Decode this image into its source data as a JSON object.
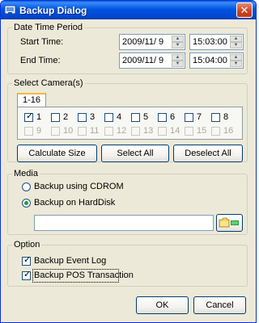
{
  "window": {
    "title": "Backup Dialog",
    "close_glyph": "✕"
  },
  "datetime": {
    "group_label": "Date Time Period",
    "start_label": "Start Time:",
    "start_date": "2009/11/  9",
    "start_time": "15:03:00",
    "end_label": "End Time:",
    "end_date": "2009/11/  9",
    "end_time": "15:04:00"
  },
  "cameras": {
    "group_label": "Select Camera(s)",
    "tab_label": "1-16",
    "items": [
      {
        "label": "1",
        "checked": true,
        "enabled": true
      },
      {
        "label": "2",
        "checked": false,
        "enabled": true
      },
      {
        "label": "3",
        "checked": false,
        "enabled": true
      },
      {
        "label": "4",
        "checked": false,
        "enabled": true
      },
      {
        "label": "5",
        "checked": false,
        "enabled": true
      },
      {
        "label": "6",
        "checked": false,
        "enabled": true
      },
      {
        "label": "7",
        "checked": false,
        "enabled": true
      },
      {
        "label": "8",
        "checked": false,
        "enabled": true
      },
      {
        "label": "9",
        "checked": false,
        "enabled": false
      },
      {
        "label": "10",
        "checked": false,
        "enabled": false
      },
      {
        "label": "11",
        "checked": false,
        "enabled": false
      },
      {
        "label": "12",
        "checked": false,
        "enabled": false
      },
      {
        "label": "13",
        "checked": false,
        "enabled": false
      },
      {
        "label": "14",
        "checked": false,
        "enabled": false
      },
      {
        "label": "15",
        "checked": false,
        "enabled": false
      },
      {
        "label": "16",
        "checked": false,
        "enabled": false
      }
    ],
    "calc_button": "Calculate Size",
    "select_all_button": "Select All",
    "deselect_all_button": "Deselect All"
  },
  "media": {
    "group_label": "Media",
    "cdrom_label": "Backup using CDROM",
    "harddisk_label": "Backup on HardDisk",
    "selected": "harddisk",
    "path_value": ""
  },
  "option": {
    "group_label": "Option",
    "event_log_label": "Backup Event Log",
    "event_log_checked": true,
    "pos_label": "Backup POS Transaction",
    "pos_checked": true
  },
  "footer": {
    "ok_label": "OK",
    "cancel_label": "Cancel"
  },
  "colors": {
    "titlebar": "#0054e3",
    "check": "#21a121",
    "dialog_bg": "#ece9d8"
  }
}
